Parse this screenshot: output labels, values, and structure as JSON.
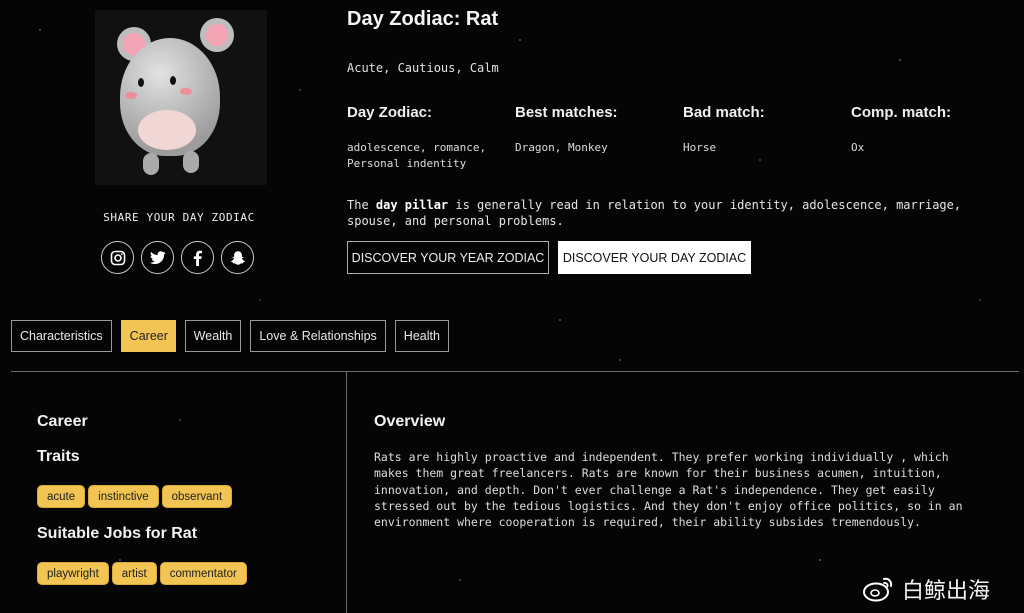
{
  "header": {
    "title": "Day Zodiac: Rat",
    "traits": "Acute, Cautious, Calm"
  },
  "columns": [
    {
      "heading": "Day Zodiac:",
      "value": "adolescence, romance,",
      "value2": "Personal indentity"
    },
    {
      "heading": "Best matches:",
      "value": "Dragon, Monkey"
    },
    {
      "heading": "Bad match:",
      "value": "Horse"
    },
    {
      "heading": "Comp. match:",
      "value": "Ox"
    }
  ],
  "description": {
    "prefix": "The ",
    "bold": "day pillar",
    "suffix": " is generally read in relation to your identity, adolescence, marriage, spouse, and personal problems."
  },
  "buttons": {
    "year": "DISCOVER YOUR YEAR ZODIAC",
    "day": "DISCOVER YOUR DAY ZODIAC"
  },
  "share": {
    "label": "SHARE YOUR DAY ZODIAC",
    "icons": [
      "instagram-icon",
      "twitter-icon",
      "facebook-icon",
      "snapchat-icon"
    ]
  },
  "tabs": [
    {
      "label": "Characteristics",
      "active": false
    },
    {
      "label": "Career",
      "active": true
    },
    {
      "label": "Wealth",
      "active": false
    },
    {
      "label": "Love & Relationships",
      "active": false
    },
    {
      "label": "Health",
      "active": false
    }
  ],
  "sidebar": {
    "section_title": "Career",
    "traits_title": "Traits",
    "traits": [
      "acute",
      "instinctive",
      "observant"
    ],
    "jobs_title": "Suitable Jobs for Rat",
    "jobs": [
      "playwright",
      "artist",
      "commentator"
    ]
  },
  "overview": {
    "title": "Overview",
    "text": "Rats are highly proactive and independent. They prefer working individually , which makes them great freelancers. Rats are known for their business acumen, intuition, innovation, and depth. Don't ever challenge a Rat's independence. They get easily stressed out by the tedious logistics. And they don't enjoy office politics, so in an environment where cooperation is required, their ability subsides tremendously."
  },
  "watermark": {
    "text": "白鲸出海"
  },
  "colors": {
    "accent": "#f1c453",
    "background": "#050505"
  }
}
